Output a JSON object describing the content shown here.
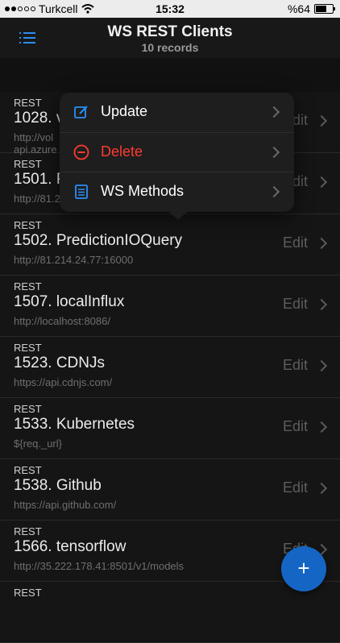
{
  "status_bar": {
    "carrier": "Turkcell",
    "time": "15:32",
    "battery": "%64",
    "battery_level": 0.64
  },
  "nav": {
    "title": "WS REST Clients",
    "subtitle": "10 records",
    "menu_icon": "list-icon"
  },
  "list": [
    {
      "type": "REST",
      "name": "1028. v",
      "url": "http://vol",
      "url2": "api.azure",
      "edit": "Edit"
    },
    {
      "type": "REST",
      "name": "1501. P",
      "url": "http://81.214.24.77:16070",
      "edit": "Edit"
    },
    {
      "type": "REST",
      "name": "1502. PredictionIOQuery",
      "url": "http://81.214.24.77:16000",
      "edit": "Edit"
    },
    {
      "type": "REST",
      "name": "1507. localInflux",
      "url": "http://localhost:8086/",
      "edit": "Edit"
    },
    {
      "type": "REST",
      "name": "1523. CDNJs",
      "url": "https://api.cdnjs.com/",
      "edit": "Edit"
    },
    {
      "type": "REST",
      "name": "1533. Kubernetes",
      "url": "${req._url}",
      "edit": "Edit"
    },
    {
      "type": "REST",
      "name": "1538. Github",
      "url": "https://api.github.com/",
      "edit": "Edit"
    },
    {
      "type": "REST",
      "name": "1566. tensorflow",
      "url": "http://35.222.178.41:8501/v1/models",
      "edit": "Edit"
    },
    {
      "type": "REST",
      "name": "",
      "url": "",
      "edit": ""
    }
  ],
  "popover": {
    "items": [
      {
        "label": "Update",
        "icon": "edit-icon",
        "color": "#ffffff"
      },
      {
        "label": "Delete",
        "icon": "minus-circle-icon",
        "color": "#ff3b30"
      },
      {
        "label": "WS Methods",
        "icon": "document-list-icon",
        "color": "#ffffff"
      }
    ]
  },
  "fab": {
    "label": "+",
    "icon": "plus-icon"
  },
  "colors": {
    "accent": "#2a8ff7",
    "danger": "#ff3b30",
    "fab": "#1566c4"
  }
}
